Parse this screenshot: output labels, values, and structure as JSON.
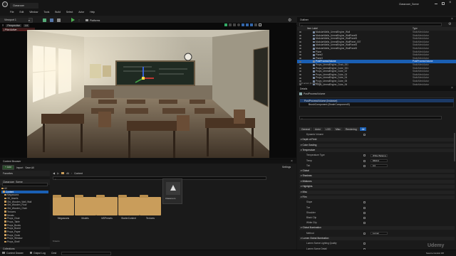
{
  "app": {
    "tab_title": "Classroom",
    "window_title": "Classroom_Scene"
  },
  "menu": [
    "File",
    "Edit",
    "Window",
    "Tools",
    "Build",
    "Select",
    "Actor",
    "Help"
  ],
  "toolbar": {
    "mode_label": "Select Mode",
    "platforms_label": "Platforms"
  },
  "viewport": {
    "tab_label": "Viewport 1",
    "perspective_label": "Perspective",
    "lit_label": "Lit",
    "pie_banner": "| Pilot Active -",
    "screen_percentage": "Screen Percentage: 100%"
  },
  "outliner": {
    "title": "Outliner",
    "col_label": "Item Label",
    "col_type": "Type",
    "rows": [
      {
        "label": "ModularWalls_UnrealEngine_Wall",
        "type": "StaticMeshActor"
      },
      {
        "label": "ModularWalls_UnrealEngine_WallPanel5",
        "type": "StaticMeshActor"
      },
      {
        "label": "ModularWalls_UnrealEngine_WallPanel5",
        "type": "StaticMeshActor"
      },
      {
        "label": "ModularWalls_UnrealEngine_WallPanel_007",
        "type": "StaticMeshActor"
      },
      {
        "label": "ModularWalls_UnrealEngine_WallPanel5",
        "type": "StaticMeshActor"
      },
      {
        "label": "ModularWalls_UnrealEngine_WallPanel5",
        "type": "StaticMeshActor"
      },
      {
        "label": "Plane",
        "type": "StaticMeshActor"
      },
      {
        "label": "Plane2",
        "type": "StaticMeshActor"
      },
      {
        "label": "Plane3",
        "type": "StaticMeshActor"
      },
      {
        "label": "PostProcessVolume",
        "type": "PostProcessVolume",
        "selected": true
      },
      {
        "label": "Props_UnrealEngine_Chair_001",
        "type": "StaticMeshActor"
      },
      {
        "label": "Props_UnrealEngine_Cube_001",
        "type": "StaticMeshActor"
      },
      {
        "label": "Props_UnrealEngine_Cube_02",
        "type": "StaticMeshActor"
      },
      {
        "label": "Props_UnrealEngine_Cube_03",
        "type": "StaticMeshActor"
      },
      {
        "label": "Props_UnrealEngine_Cube_04",
        "type": "StaticMeshActor"
      },
      {
        "label": "Props_UnrealEngine_Cube_05",
        "type": "StaticMeshActor"
      },
      {
        "label": "Props_UnrealEngine_Cube_06",
        "type": "StaticMeshActor"
      }
    ],
    "footer": "216 actors (1 selected)"
  },
  "details": {
    "title": "Details",
    "object_name": "PostProcessVolume",
    "instance_label": "PostProcessVolume (Instance)",
    "component_label": "BrushComponent (BrushComponent0)",
    "filter_tabs": [
      "General",
      "Actor",
      "LOD",
      "Misc",
      "Rendering",
      "All"
    ],
    "sections": [
      {
        "label": "Dynamic Volume",
        "kind": "row"
      },
      {
        "label": "Depth of Field",
        "kind": "section"
      },
      {
        "label": "Color Grading",
        "kind": "section"
      },
      {
        "label": "Temperature",
        "kind": "section"
      },
      {
        "label": "Temperature Type",
        "kind": "row",
        "value": "White Balance"
      },
      {
        "label": "Temp",
        "kind": "row",
        "value": "6500.0",
        "checked": true
      },
      {
        "label": "Tint",
        "kind": "row",
        "value": "0.0",
        "checked": true
      },
      {
        "label": "Global",
        "kind": "section"
      },
      {
        "label": "Shadows",
        "kind": "section"
      },
      {
        "label": "Midtones",
        "kind": "section"
      },
      {
        "label": "Highlights",
        "kind": "section"
      },
      {
        "label": "Misc",
        "kind": "section"
      },
      {
        "label": "Film",
        "kind": "section"
      },
      {
        "label": "Slope",
        "kind": "row"
      },
      {
        "label": "Toe",
        "kind": "row"
      },
      {
        "label": "Shoulder",
        "kind": "row"
      },
      {
        "label": "Black Clip",
        "kind": "row"
      },
      {
        "label": "White Clip",
        "kind": "row"
      },
      {
        "label": "Global Illumination",
        "kind": "section"
      },
      {
        "label": "Method",
        "kind": "row",
        "value": "Lumen"
      },
      {
        "label": "Lumen Global Illumination",
        "kind": "section"
      },
      {
        "label": "Lumen Scene Lighting Quality",
        "kind": "row"
      },
      {
        "label": "Lumen Scene Detail",
        "kind": "row"
      }
    ]
  },
  "content_browser": {
    "title": "Content Browser",
    "add_label": "+ Add",
    "import_label": "Import",
    "save_all_label": "Save All",
    "settings_label": "Settings",
    "favorites_label": "Favorites",
    "project_label": "Classroom_Scene",
    "path": [
      "All",
      "Content"
    ],
    "tree": [
      "All",
      "Content",
      "Megascans",
      "3D_Assets",
      "Old_Wooden_Wall_Wall",
      "Old_Wooden_Floor",
      "Old_Wooden_Chair",
      "Textures",
      "Decals",
      "Props_Chair",
      "Props_Table",
      "Props_Books",
      "Props_Board",
      "Props_Paper",
      "Props_Clock",
      "Props_Window",
      "Props_Shelf"
    ],
    "collections_label": "Collections",
    "folders": [
      "Megascans",
      "Models",
      "MSPresets",
      "StarterContent",
      "Textures"
    ],
    "asset_name": "Classroom",
    "items_count": "6 items"
  },
  "status": {
    "content_drawer": "Content Drawer",
    "output_log": "Output Log",
    "cmd": "Cmd",
    "source_control": "Source Control Off",
    "watermark": "Udemy"
  }
}
